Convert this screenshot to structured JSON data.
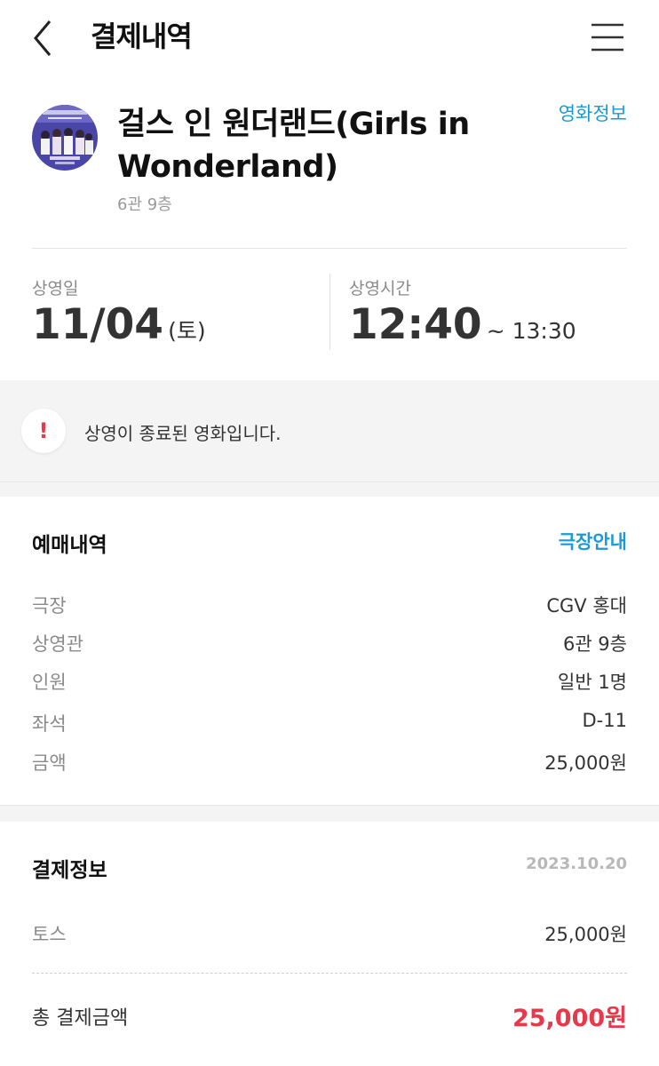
{
  "header": {
    "title": "결제내역"
  },
  "movie": {
    "title": "걸스 인 원더랜드(Girls in Wonderland)",
    "subtitle": "6관 9층",
    "info_link": "영화정보"
  },
  "schedule": {
    "date_label": "상영일",
    "date_value": "11/04",
    "day": "(토)",
    "time_label": "상영시간",
    "start_time": "12:40",
    "end_time": "~ 13:30"
  },
  "notice": {
    "text": "상영이 종료된 영화입니다."
  },
  "booking": {
    "title": "예매내역",
    "link": "극장안내",
    "rows": [
      {
        "label": "극장",
        "value": "CGV 홍대"
      },
      {
        "label": "상영관",
        "value": "6관 9층"
      },
      {
        "label": "인원",
        "value": "일반 1명"
      },
      {
        "label": "좌석",
        "value": "D-11"
      },
      {
        "label": "금액",
        "value": "25,000원"
      }
    ]
  },
  "payment": {
    "title": "결제정보",
    "date": "2023.10.20",
    "rows": [
      {
        "label": "토스",
        "value": "25,000원"
      }
    ],
    "total_label": "총 결제금액",
    "total_value": "25,000원"
  },
  "colors": {
    "accent_blue": "#1a9ad6",
    "alert_red": "#e8394c"
  }
}
